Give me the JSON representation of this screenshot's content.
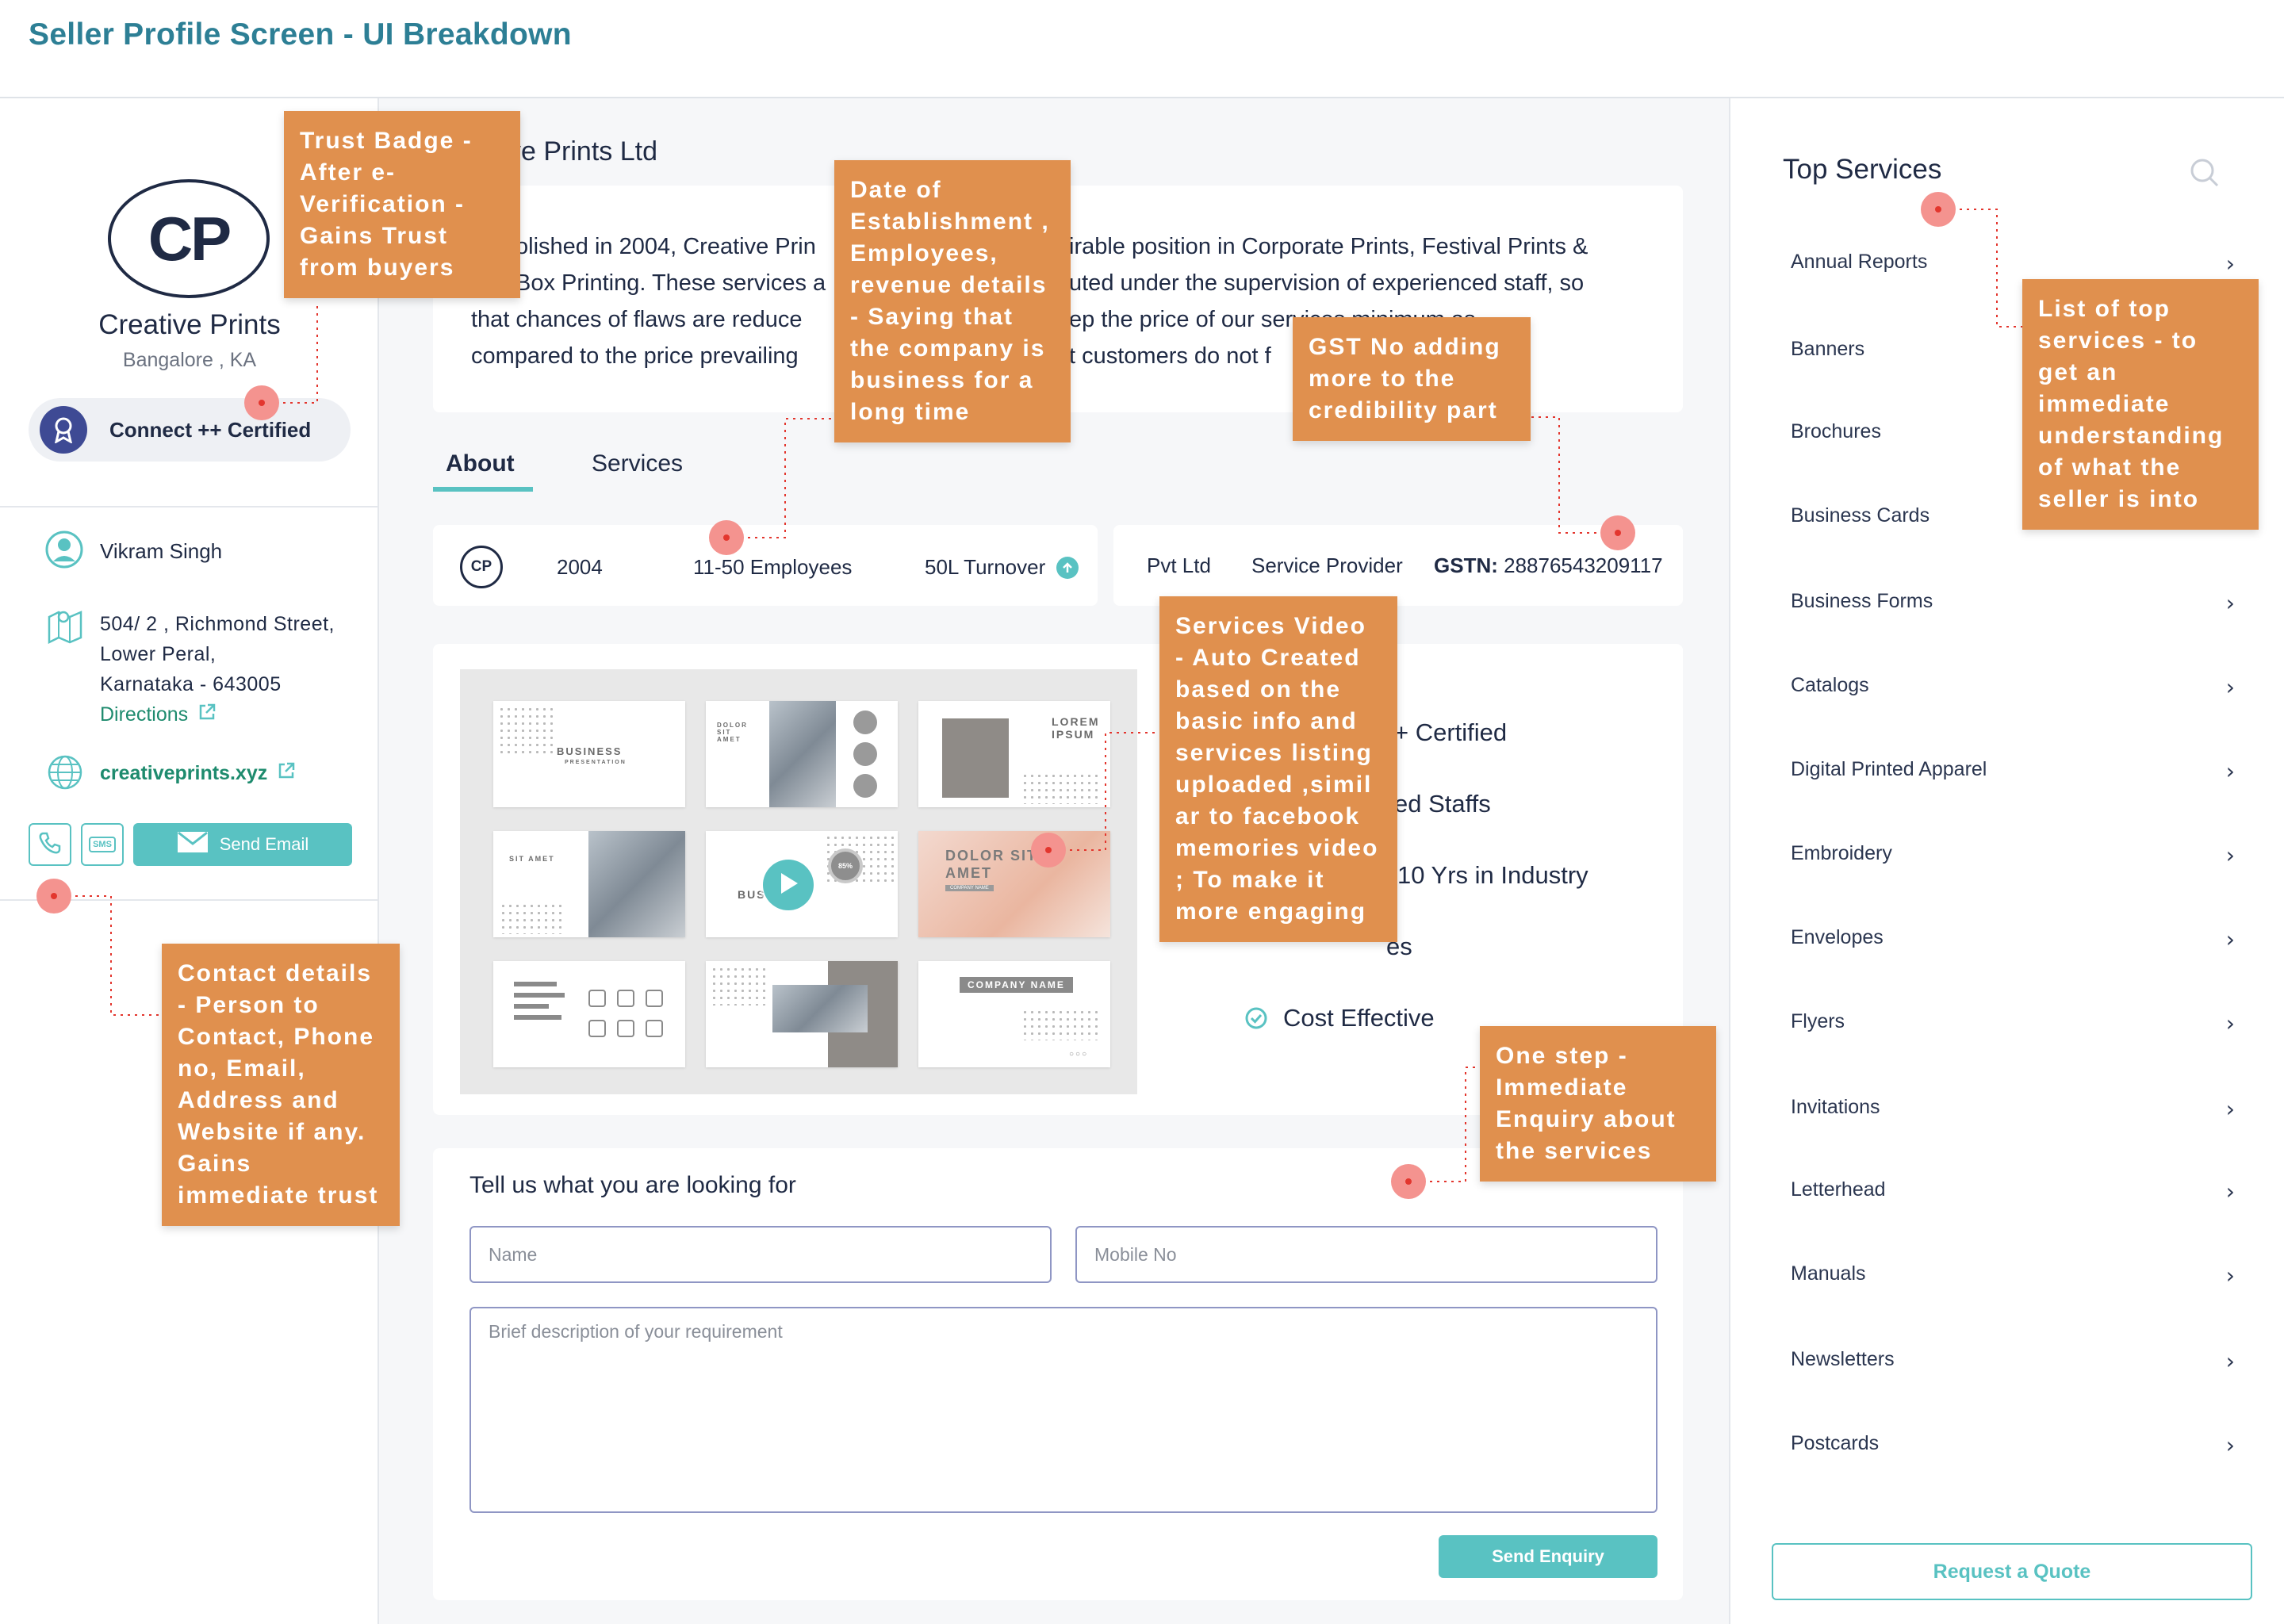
{
  "header": {
    "title": "Seller Profile Screen - UI Breakdown"
  },
  "seller": {
    "logo_text": "CP",
    "name": "Creative Prints",
    "location": "Bangalore , KA",
    "certified_label": "Connect ++ Certified",
    "contact_person": "Vikram Singh",
    "address_line1": "504/ 2 , Richmond Street,",
    "address_line2": "Lower Peral,",
    "address_line3": "Karnataka - 643005",
    "directions_label": "Directions",
    "website": "creativeprints.xyz",
    "sms_label": "SMS",
    "send_email_label": "Send Email"
  },
  "company": {
    "title": "Creative Prints Ltd",
    "title_visible": "ve Prints Ltd",
    "about_lines": [
      "olished in 2004, Creative Prin",
      "Box Printing. These services a",
      "that chances of flaws are reduce",
      "compared to the price prevailing"
    ],
    "about_lines_right": [
      "irable position in Corporate Prints, Festival Prints &",
      "uted under the supervision of experienced staff, so",
      "ep the price of our services minimum as",
      "t customers do not f"
    ]
  },
  "tabs": [
    {
      "label": "About"
    },
    {
      "label": "Services"
    }
  ],
  "stats": {
    "logo_text": "CP",
    "year": "2004",
    "employees": "11-50 Employees",
    "turnover": "50L Turnover",
    "company_type": "Pvt Ltd",
    "role": "Service Provider",
    "gstn_label": "GSTN:",
    "gstn_value": "28876543209117"
  },
  "highlights": [
    {
      "text": "+ Certified"
    },
    {
      "text": "ed Staffs"
    },
    {
      "text": "10 Yrs in Industry"
    },
    {
      "text": "es"
    },
    {
      "text": "Cost Effective"
    }
  ],
  "video_thumbs": {
    "t1": "BUSINESS",
    "t1_sub": "PRESENTATION",
    "t2": "DOLOR SIT AMET",
    "t3": "LOREM IPSUM",
    "t4": "SIT AMET",
    "t5": "BUS",
    "t5_badge": "85%",
    "t6": "DOLOR SIT AMET",
    "t6_sub": "COMPANY NAME",
    "t9": "COMPANY NAME"
  },
  "enquiry": {
    "heading": "Tell us what you are looking for",
    "name_placeholder": "Name",
    "mobile_placeholder": "Mobile No",
    "description_placeholder": "Brief description of your requirement",
    "submit_label": "Send Enquiry"
  },
  "top_services": {
    "title": "Top Services",
    "items": [
      "Annual Reports",
      "Banners",
      "Brochures",
      "Business Cards",
      "Business Forms",
      "Catalogs",
      "Digital Printed Apparel",
      "Embroidery",
      "Envelopes",
      "Flyers",
      "Invitations",
      "Letterhead",
      "Manuals",
      "Newsletters",
      "Postcards"
    ],
    "quote_label": "Request a Quote"
  },
  "annotations": {
    "trust_badge": "Trust Badge - After e-Verification - Gains Trust from buyers",
    "establishment": "Date of Establishment , Employees, revenue details - Saying that the company is business for a long time",
    "gst": "GST No adding more to the credibility part",
    "top_services": "List of top services - to get an immediate understanding of what the seller is into",
    "video": "Services Video - Auto Created based on the basic info and services listing uploaded ,simil ar to facebook memories video ; To make it more engaging",
    "contact": "Contact details - Person to Contact, Phone no, Email, Address and Website if any. Gains immediate trust",
    "enquiry": "One step - Immediate Enquiry about the services"
  },
  "colors": {
    "accent": "#59c2c2",
    "title": "#2d7f95",
    "annotation": "#e0904e",
    "pin": "#f4938f",
    "link": "#1e8b6e",
    "navy": "#1f2a44"
  }
}
